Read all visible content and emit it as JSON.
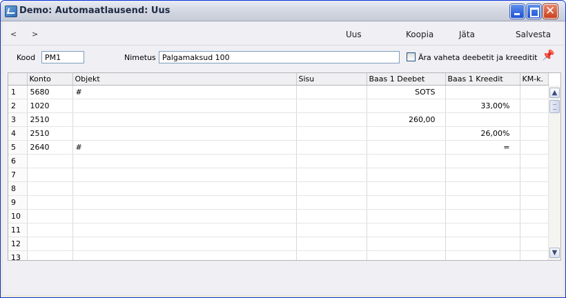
{
  "window": {
    "title": "Demo: Automaatlausend: Uus"
  },
  "toolbar": {
    "prev": "<",
    "next": ">",
    "new_label": "Uus",
    "copy_label": "Koopia",
    "cancel_label": "Jäta",
    "save_label": "Salvesta"
  },
  "form": {
    "code_label": "Kood",
    "code_value": "PM1",
    "name_label": "Nimetus",
    "name_value": "Palgamaksud 100",
    "swap_label": "Ära vaheta deebetit ja kreeditit"
  },
  "grid": {
    "columns": [
      "",
      "Konto",
      "Objekt",
      "Sisu",
      "Baas 1 Deebet",
      "Baas 1 Kreedit",
      "KM-k."
    ],
    "rows": [
      {
        "n": "1",
        "konto": "5680",
        "objekt": "#",
        "sisu": "",
        "deebet": "SOTS",
        "kreedit": "",
        "km": ""
      },
      {
        "n": "2",
        "konto": "1020",
        "objekt": "",
        "sisu": "",
        "deebet": "",
        "kreedit": "33,00%",
        "km": ""
      },
      {
        "n": "3",
        "konto": "2510",
        "objekt": "",
        "sisu": "",
        "deebet": "260,00",
        "kreedit": "",
        "km": ""
      },
      {
        "n": "4",
        "konto": "2510",
        "objekt": "",
        "sisu": "",
        "deebet": "",
        "kreedit": "26,00%",
        "km": ""
      },
      {
        "n": "5",
        "konto": "2640",
        "objekt": "#",
        "sisu": "",
        "deebet": "",
        "kreedit": "=",
        "km": ""
      },
      {
        "n": "6",
        "konto": "",
        "objekt": "",
        "sisu": "",
        "deebet": "",
        "kreedit": "",
        "km": ""
      },
      {
        "n": "7",
        "konto": "",
        "objekt": "",
        "sisu": "",
        "deebet": "",
        "kreedit": "",
        "km": ""
      },
      {
        "n": "8",
        "konto": "",
        "objekt": "",
        "sisu": "",
        "deebet": "",
        "kreedit": "",
        "km": ""
      },
      {
        "n": "9",
        "konto": "",
        "objekt": "",
        "sisu": "",
        "deebet": "",
        "kreedit": "",
        "km": ""
      },
      {
        "n": "10",
        "konto": "",
        "objekt": "",
        "sisu": "",
        "deebet": "",
        "kreedit": "",
        "km": ""
      },
      {
        "n": "11",
        "konto": "",
        "objekt": "",
        "sisu": "",
        "deebet": "",
        "kreedit": "",
        "km": ""
      },
      {
        "n": "12",
        "konto": "",
        "objekt": "",
        "sisu": "",
        "deebet": "",
        "kreedit": "",
        "km": ""
      },
      {
        "n": "13",
        "konto": "",
        "objekt": "",
        "sisu": "",
        "deebet": "",
        "kreedit": "",
        "km": ""
      }
    ]
  },
  "icons": {
    "app": "window-app-icon",
    "pin": "pushpin-icon",
    "scroll_up": "scroll-up-arrow-icon",
    "scroll_down": "scroll-down-arrow-icon"
  }
}
